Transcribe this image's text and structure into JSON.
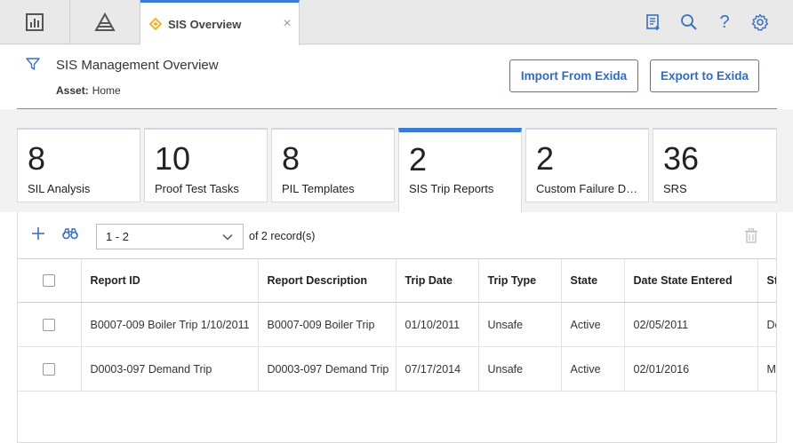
{
  "topbar": {
    "active_tab": {
      "label": "SIS Overview",
      "icon": "diamond-icon",
      "close": "×"
    },
    "left_tabs": [
      {
        "icon": "dashboard-icon"
      },
      {
        "icon": "hierarchy-icon"
      }
    ],
    "right_icons": [
      "report-icon",
      "search-icon",
      "help-icon",
      "gear-icon"
    ],
    "help_glyph": "?"
  },
  "header": {
    "title": "SIS Management Overview",
    "asset_label": "Asset:",
    "asset_value": "Home",
    "import_button": "Import From Exida",
    "export_button": "Export to Exida"
  },
  "cards": [
    {
      "count": "8",
      "label": "SIL Analysis",
      "active": false
    },
    {
      "count": "10",
      "label": "Proof Test Tasks",
      "active": false
    },
    {
      "count": "8",
      "label": "PIL Templates",
      "active": false
    },
    {
      "count": "2",
      "label": "SIS Trip Reports",
      "active": true
    },
    {
      "count": "2",
      "label": "Custom Failure Data",
      "active": false
    },
    {
      "count": "36",
      "label": "SRS",
      "active": false
    }
  ],
  "toolbar": {
    "range": "1 - 2",
    "of_label": "of",
    "record_count": "2",
    "records_label": "record(s)"
  },
  "table": {
    "columns": [
      "",
      "Report ID",
      "Report Description",
      "Trip Date",
      "Trip Type",
      "State",
      "Date State Entered",
      "St"
    ],
    "rows": [
      {
        "report_id": "B0007-009 Boiler Trip 1/10/2011",
        "description": "B0007-009 Boiler Trip",
        "trip_date": "01/10/2011",
        "trip_type": "Unsafe",
        "state": "Active",
        "date_state_entered": "02/05/2011",
        "extra": "De"
      },
      {
        "report_id": "D0003-097 Demand Trip",
        "description": "D0003-097 Demand Trip",
        "trip_date": "07/17/2014",
        "trip_type": "Unsafe",
        "state": "Active",
        "date_state_entered": "02/01/2016",
        "extra": "M"
      }
    ]
  },
  "colors": {
    "accent": "#3a7bd5",
    "link": "#3a6fc4",
    "diamond": "#f0b429"
  }
}
